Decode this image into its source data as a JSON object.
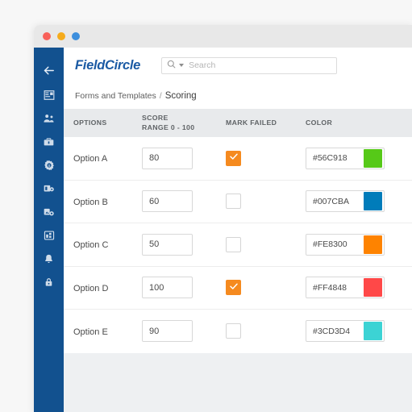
{
  "window": {
    "controls": [
      {
        "name": "close",
        "color": "#f8615a"
      },
      {
        "name": "minimize",
        "color": "#f5ab1c"
      },
      {
        "name": "maximize",
        "color": "#3d8fdd"
      }
    ]
  },
  "sidebar": {
    "background": "#12518f",
    "items": [
      {
        "icon": "back-arrow-icon",
        "label": "Back"
      },
      {
        "icon": "dashboard-icon",
        "label": "Dashboard"
      },
      {
        "icon": "people-icon",
        "label": "Customers"
      },
      {
        "icon": "briefcase-icon",
        "label": "Jobs"
      },
      {
        "icon": "gear-icon",
        "label": "Settings"
      },
      {
        "icon": "estimate-icon",
        "label": "Estimates"
      },
      {
        "icon": "map-pin-icon",
        "label": "Locations"
      },
      {
        "icon": "reports-icon",
        "label": "Reports"
      },
      {
        "icon": "bell-icon",
        "label": "Notifications"
      },
      {
        "icon": "lock-icon",
        "label": "Security"
      }
    ]
  },
  "topbar": {
    "brand": "FieldCircle",
    "brand_color": "#1c5ba4",
    "search": {
      "icon": "search-icon",
      "placeholder": "Search",
      "value": "",
      "dropdown_icon": "chevron-down-icon"
    }
  },
  "breadcrumb": {
    "parent": "Forms and Templates",
    "separator": "/",
    "current": "Scoring"
  },
  "table": {
    "headers": {
      "options": "OPTIONS",
      "score_line1": "SCORE",
      "score_line2": "RANGE 0 - 100",
      "mark_failed": "MARK FAILED",
      "color": "COLOR"
    },
    "accent_checked": "#f58a1f",
    "rows": [
      {
        "option": "Option A",
        "score": "80",
        "mark_failed": true,
        "color_hex": "#56C918",
        "swatch": "#56C918"
      },
      {
        "option": "Option B",
        "score": "60",
        "mark_failed": false,
        "color_hex": "#007CBA",
        "swatch": "#007CBA"
      },
      {
        "option": "Option C",
        "score": "50",
        "mark_failed": false,
        "color_hex": "#FE8300",
        "swatch": "#FE8300"
      },
      {
        "option": "Option D",
        "score": "100",
        "mark_failed": true,
        "color_hex": "#FF4848",
        "swatch": "#FF4848"
      },
      {
        "option": "Option E",
        "score": "90",
        "mark_failed": false,
        "color_hex": "#3CD3D4",
        "swatch": "#3CD3D4"
      }
    ]
  }
}
